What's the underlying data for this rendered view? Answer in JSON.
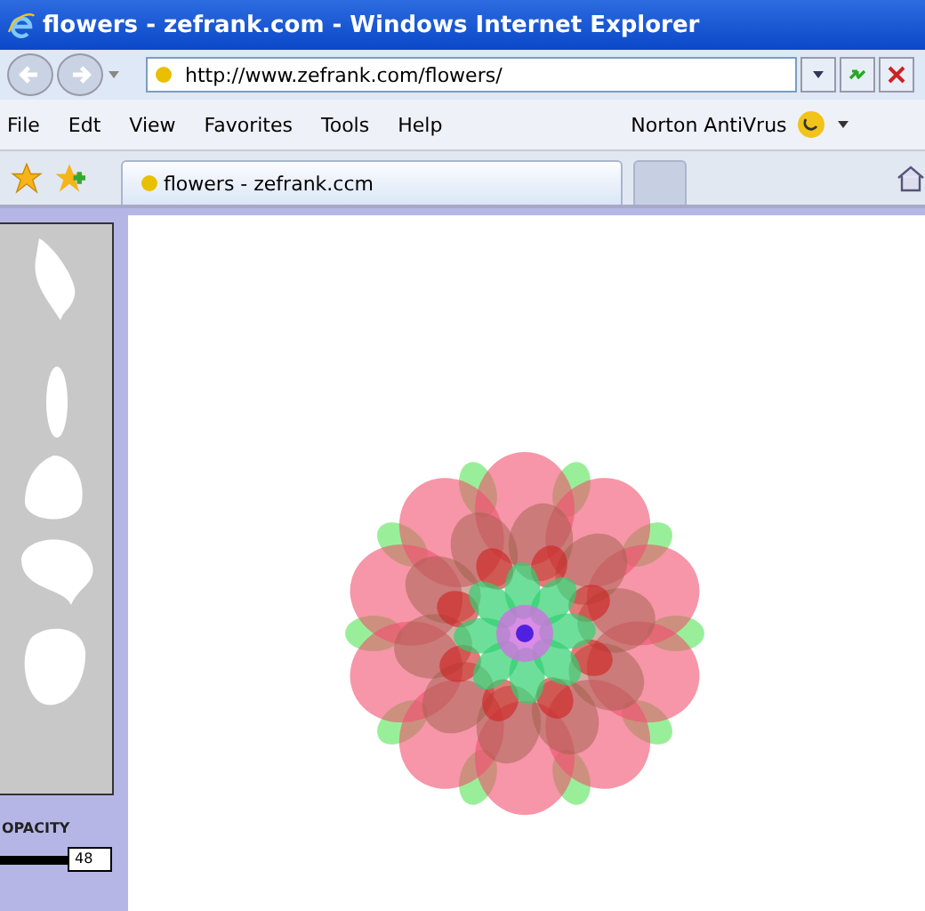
{
  "window": {
    "title": "flowers - zefrank.com - Windows Internet Explorer"
  },
  "address_bar": {
    "value": "http://www.zefrank.com/flowers/"
  },
  "menu": [
    "File",
    "Edt",
    "View",
    "Favorites",
    "Tools",
    "Help"
  ],
  "toolbar": {
    "norton": "Norton AntiVrus"
  },
  "tabs": [
    {
      "label": "flowers - zefrank.ccm",
      "selected": true
    },
    {
      "selected": false
    }
  ],
  "panel": {
    "opacity_label": "OPACITY",
    "opacity_value": "48",
    "opacity_slider": {
      "level": 1
    }
  }
}
